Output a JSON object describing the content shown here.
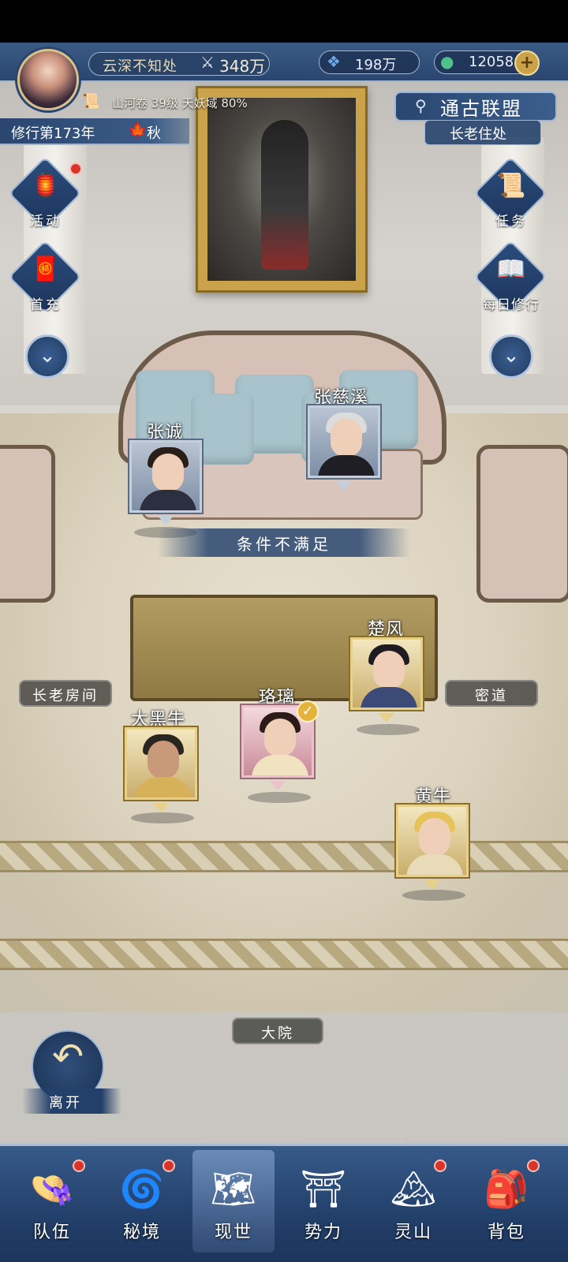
{
  "hud": {
    "player_name": "云深不知处",
    "power_icon": "crossed-swords-icon",
    "power": "348万",
    "spirit_stone": "198万",
    "jade": "12058",
    "stage": "山河卷 39级 天妖域 80%",
    "year": "修行第173年",
    "season": "秋"
  },
  "location": {
    "title": "通古联盟",
    "subtitle": "长老住处"
  },
  "side_buttons": {
    "activity": "活动",
    "first_recharge": "首充",
    "quest": "任务",
    "daily": "每日修行"
  },
  "npcs": {
    "zhang_cheng": "张诚",
    "zhang_cixi": "张慈溪",
    "chu_feng": "楚风",
    "luo_li": "珞璃",
    "da_hei_niu": "大黑牛",
    "huang_niu": "黄牛"
  },
  "notice": "条件不满足",
  "rooms": {
    "elder_room": "长老房间",
    "secret_passage": "密道",
    "courtyard": "大院"
  },
  "leave": "离开",
  "nav": [
    {
      "label": "队伍",
      "icon": "straw-hat-icon"
    },
    {
      "label": "秘境",
      "icon": "portal-icon"
    },
    {
      "label": "现世",
      "icon": "scroll-map-icon"
    },
    {
      "label": "势力",
      "icon": "palace-icon"
    },
    {
      "label": "灵山",
      "icon": "mountain-icon"
    },
    {
      "label": "背包",
      "icon": "bag-icon"
    }
  ],
  "colors": {
    "hud_blue": "#2a4670",
    "accent_gold": "#c9a24a",
    "alert_red": "#d9342b"
  }
}
